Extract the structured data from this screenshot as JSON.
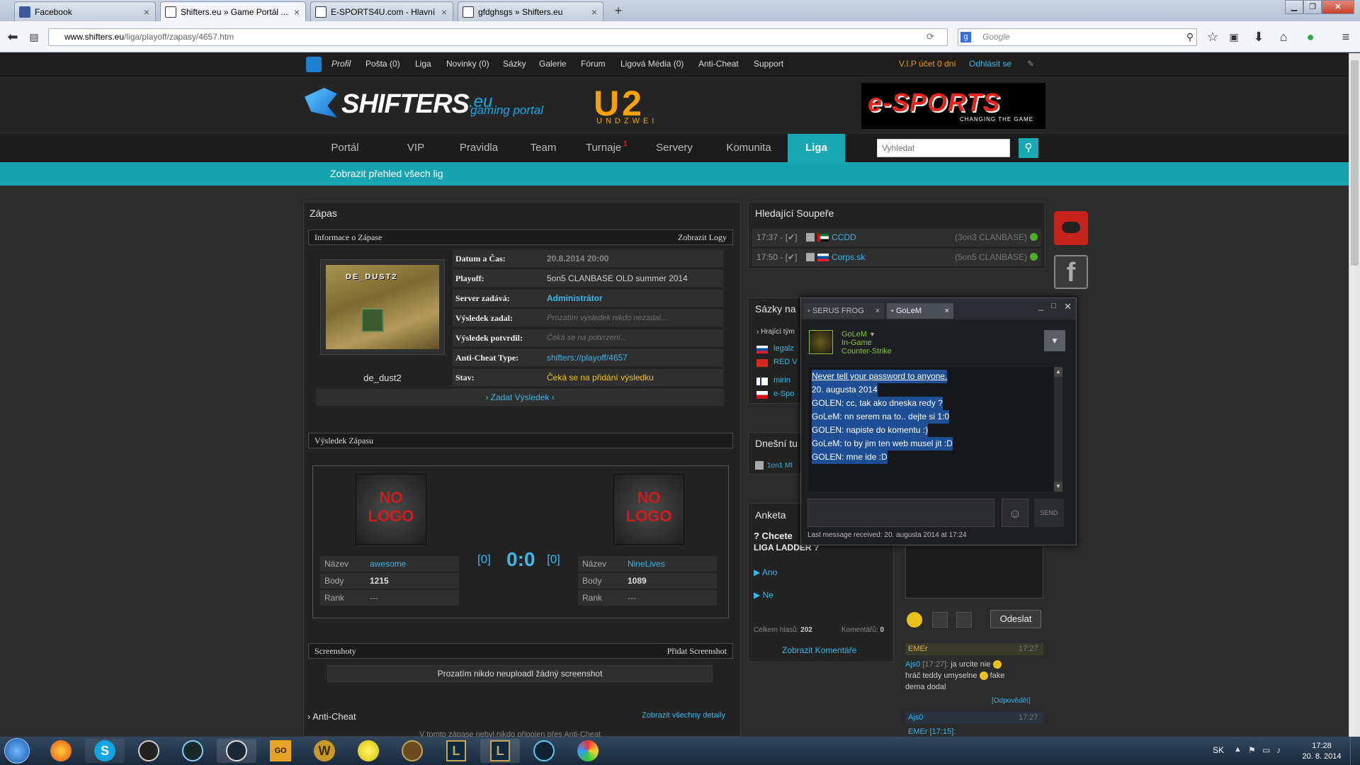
{
  "browser": {
    "tabs": [
      {
        "label": "Facebook",
        "color": "#3b5998",
        "active": false
      },
      {
        "label": "Shifters.eu » Game Portál ...",
        "color": "#1ba8b5",
        "active": true
      },
      {
        "label": "E-SPORTS4U.com - Hlavní ...",
        "color": "#cc2222",
        "active": false
      },
      {
        "label": "gfdghsgs » Shifters.eu",
        "color": "#1ba8b5",
        "active": false
      }
    ],
    "new_tab": "+",
    "url_host": "www.shifters.eu",
    "url_path": "/liga/playoff/zapasy/4657.htm",
    "search_placeholder": "Google"
  },
  "topbar": {
    "items": [
      "Profil",
      "Pošta (0)",
      "Liga",
      "Novinky (0)",
      "Sázky",
      "Galerie",
      "Fórum",
      "Ligová Média (0)",
      "Anti-Cheat",
      "Support"
    ],
    "vip": "V.I.P účet 0 dní",
    "logout": "Odhlásit se"
  },
  "header": {
    "logo_main": "SHIFTERS",
    "logo_tld": ".eu",
    "logo_sub": "gaming portal",
    "u2_logo": "U2",
    "u2_sub": "UNDZWEI",
    "esports_logo": "e-SPORTS",
    "esports_sub": "CHANGING THE GAME"
  },
  "mainnav": {
    "items": [
      "Portál",
      "VIP",
      "Pravidla",
      "Team",
      "Turnaje",
      "Servery",
      "Komunita",
      "Liga"
    ],
    "turnaje_badge": "1",
    "search_placeholder": "Vyhledat"
  },
  "subnav": {
    "link": "Zobrazit přehled všech lig"
  },
  "match": {
    "title": "Zápas",
    "info_header": "Informace o Zápase",
    "show_logs": "Zobrazit Logy",
    "map_overlay": "DE_DUST2",
    "map_name": "de_dust2",
    "fields": [
      {
        "label": "Datum a Čas:",
        "value": "20.8.2014 20:00"
      },
      {
        "label": "Playoff:",
        "value": "5on5 CLANBASE OLD summer 2014"
      },
      {
        "label": "Server zadává:",
        "value": "Administrátor"
      },
      {
        "label": "Výsledek zadal:",
        "value": "Prozatím výsledek nikdo nezadal..."
      },
      {
        "label": "Výsledek potvrdil:",
        "value": "Čeká se na potvrzení..."
      },
      {
        "label": "Anti-Cheat Type:",
        "value": "shifters://playoff/4657"
      },
      {
        "label": "Stav:",
        "value": "Čeká se na přidání výsledku"
      }
    ],
    "enter_result": "› Zadat Výsledek ‹",
    "result_header": "Výsledek Zápasu",
    "no_logo_line1": "NO",
    "no_logo_line2": "LOGO",
    "score": "0:0",
    "score_left": "[0]",
    "score_right": "[0]",
    "team_labels": [
      "Název",
      "Body",
      "Rank"
    ],
    "team_left": {
      "name": "awesome",
      "points": "1215",
      "rank": "---"
    },
    "team_right": {
      "name": "NineLives",
      "points": "1089",
      "rank": "---"
    },
    "screens_header": "Screenshoty",
    "add_screenshot": "Přidat Screenshot",
    "no_screens": "Prozatím nikdo neuploadl žádný screenshot",
    "anticheat_title": "› Anti-Cheat",
    "anticheat_details": "Zobrazit všechny detaily",
    "anticheat_note": "V tomto zápase nebyl nikdo připojen přes Anti-Cheat"
  },
  "seeking": {
    "title": "Hledající Soupeře",
    "rows": [
      {
        "time": "17:37 - [✔]",
        "team": "CCDD",
        "type": "(3on3 CLANBASE)"
      },
      {
        "time": "17:50 - [✔]",
        "team": "Corps.sk",
        "type": "(5on5 CLANBASE)"
      }
    ]
  },
  "bets": {
    "title": "Sázky na",
    "sub": "› Hrající tým",
    "teams": [
      "legalz",
      "RED V",
      "mirin",
      "e-Spo"
    ]
  },
  "today": {
    "title": "Dnešní tu",
    "item": "1on1 MI"
  },
  "poll": {
    "title": "Anketa",
    "question1": "? Chcete",
    "question2": "LIGA LADDER ?",
    "opt_yes": "Ano",
    "opt_no": "Ne",
    "votes_label": "Celkem hlasů:",
    "votes": "202",
    "comments_label": "Komentářů:",
    "comments": "0",
    "show_comments": "Zobrazit Komentáře"
  },
  "shoutbox": {
    "send": "Odeslat",
    "msg1_user": "EMEr",
    "msg1_time": "17:27",
    "msg1_from": "Ajs0",
    "msg1_stamp": "[17:27]:",
    "msg1_text1": "ja urcite nie",
    "msg1_text2": "hráč teddy umyselne",
    "msg1_text3": "fake",
    "msg1_text4": "dema dodal",
    "reply": "[Odpovědět]",
    "msg2_user": "Ajs0",
    "msg2_time": "17:27",
    "msg2_preview": "EMEr [17:15]:"
  },
  "chat": {
    "tab1": "SERUS FROG",
    "tab2": "GoLeM",
    "user": "GoLeM",
    "status": "In-Game",
    "game": "Counter-Strike",
    "messages": [
      "Never tell your password to anyone.",
      "20. augusta 2014",
      "GOLEN: cc, tak ako dneska redy ?",
      "GoLeM: nn serem na to.. dejte si 1:0",
      "GOLEN: napiste do komentu :)",
      "GoLeM: to by jim ten web musel jit :D",
      "GOLEN: mne ide :D"
    ],
    "send": "SEND",
    "last_message": "Last message received: 20. augusta 2014 at 17:24"
  },
  "taskbar": {
    "lang": "SK",
    "time": "17:28",
    "date": "20. 8. 2014"
  }
}
